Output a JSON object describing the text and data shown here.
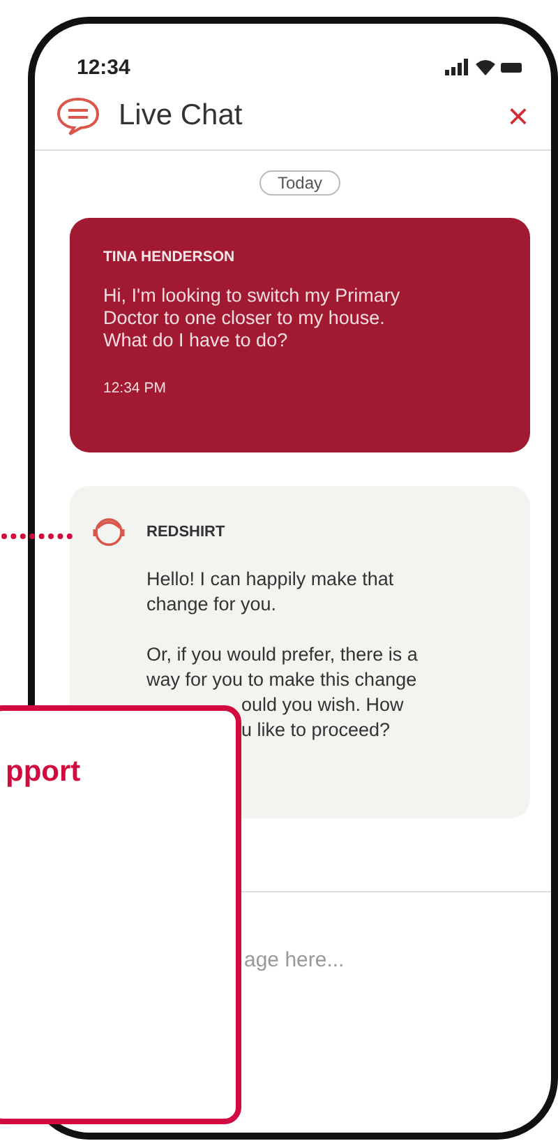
{
  "status_bar": {
    "time": "12:34"
  },
  "header": {
    "title": "Live Chat",
    "close": "×"
  },
  "date_chip": "Today",
  "messages": [
    {
      "kind": "user",
      "sender": "TINA HENDERSON",
      "paragraphs": [
        {
          "lines": [
            {
              "text": "Hi, I'm looking to switch my Primary",
              "covered": false
            },
            {
              "text": "Doctor to one closer to my house.",
              "covered": false
            },
            {
              "text": "What do I have to do?",
              "covered": false
            }
          ]
        }
      ],
      "time": "12:34 PM"
    },
    {
      "kind": "agent",
      "sender": "REDSHIRT",
      "paragraphs": [
        {
          "lines": [
            {
              "text": "Hello! I can happily make that",
              "covered": false
            },
            {
              "text": "change for you.",
              "covered": false
            }
          ]
        },
        {
          "lines": [
            {
              "text": "Or, if you would prefer, there is a",
              "covered": false
            },
            {
              "text": "way for you to make this change",
              "covered": false
            },
            {
              "text": "ould you wish. How",
              "covered": true
            },
            {
              "text": "u like to proceed?",
              "covered": true
            }
          ]
        }
      ]
    }
  ],
  "input": {
    "placeholder": "age here..."
  },
  "overlay_card": {
    "title": "pport"
  }
}
